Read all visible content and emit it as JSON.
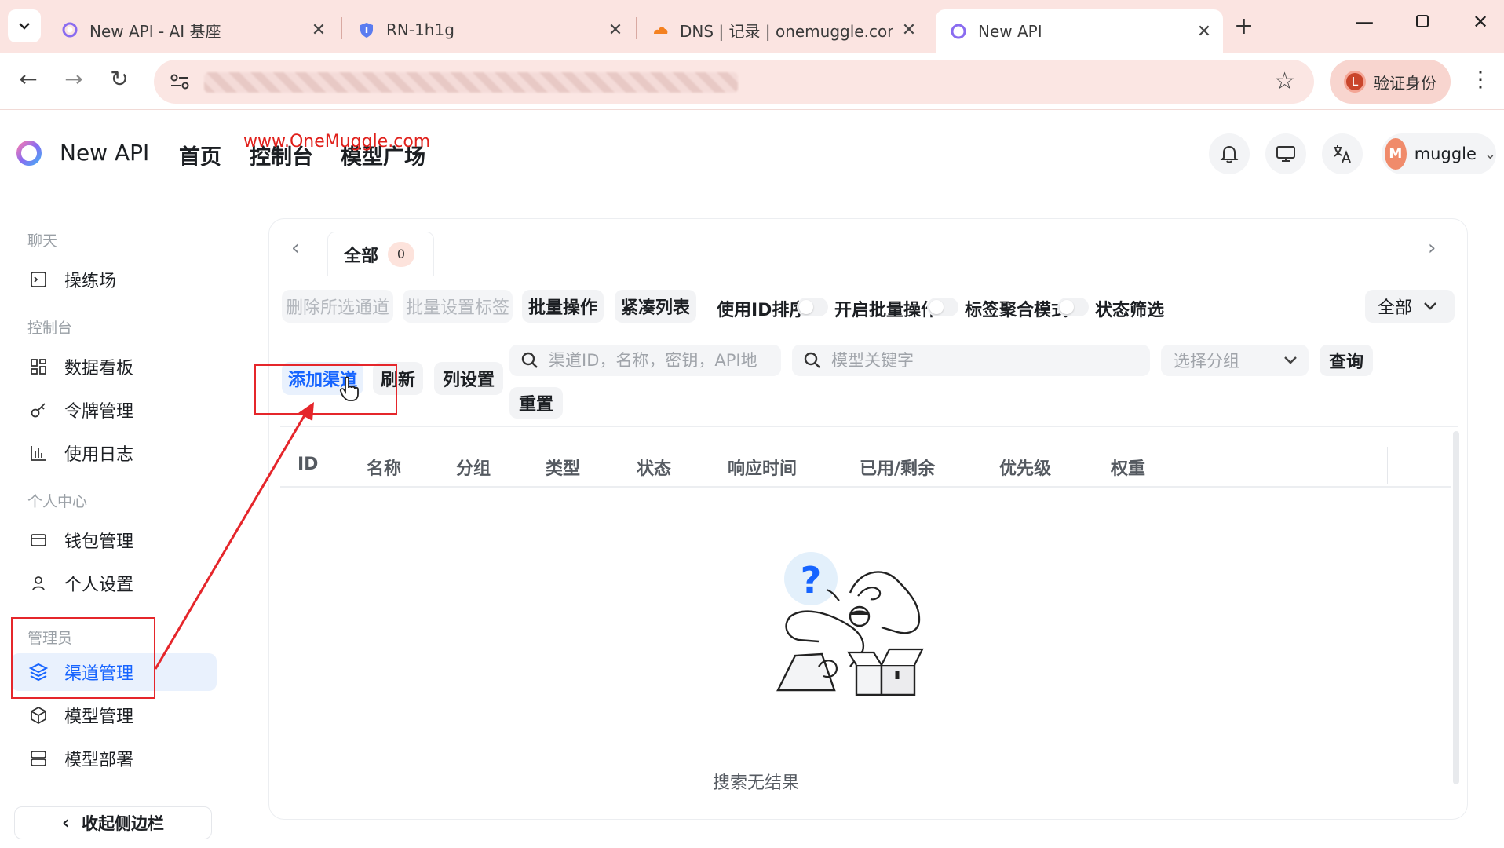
{
  "browser": {
    "tabs": [
      {
        "label": "New API - AI 基座",
        "close": "✕"
      },
      {
        "label": "RN-1h1g",
        "close": "✕"
      },
      {
        "label": "DNS | 记录 | onemuggle.com",
        "close": "✕"
      },
      {
        "label": "New API",
        "close": "✕"
      }
    ],
    "new_tab": "+",
    "verify_label": "验证身份",
    "verify_avatar": "L"
  },
  "header": {
    "app_name": "New API",
    "nav": [
      "首页",
      "控制台",
      "模型广场"
    ],
    "watermark": "www.OneMuggle.com",
    "user": {
      "avatar": "M",
      "name": "muggle"
    }
  },
  "sidebar": {
    "sections": [
      {
        "title": "聊天",
        "items": [
          {
            "label": "操练场",
            "icon": "playground-icon"
          }
        ]
      },
      {
        "title": "控制台",
        "items": [
          {
            "label": "数据看板",
            "icon": "dashboard-icon"
          },
          {
            "label": "令牌管理",
            "icon": "key-icon"
          },
          {
            "label": "使用日志",
            "icon": "chart-icon"
          }
        ]
      },
      {
        "title": "个人中心",
        "items": [
          {
            "label": "钱包管理",
            "icon": "wallet-icon"
          },
          {
            "label": "个人设置",
            "icon": "user-icon"
          }
        ]
      },
      {
        "title": "管理员",
        "items": [
          {
            "label": "渠道管理",
            "icon": "layers-icon",
            "active": true
          },
          {
            "label": "模型管理",
            "icon": "box-icon"
          },
          {
            "label": "模型部署",
            "icon": "server-icon"
          }
        ]
      }
    ],
    "collapse_label": "收起侧边栏"
  },
  "main": {
    "tab_all": {
      "label": "全部",
      "count": "0"
    },
    "toolbar": {
      "delete_selected": "删除所选通道",
      "batch_tag": "批量设置标签",
      "batch_ops": "批量操作",
      "compact_list": "紧凑列表",
      "sort_by_id": "使用ID排序",
      "enable_batch": "开启批量操作",
      "tag_aggregate": "标签聚合模式",
      "status_filter": "状态筛选",
      "status_value": "全部"
    },
    "actions": {
      "add_channel": "添加渠道",
      "refresh": "刷新",
      "column_settings": "列设置",
      "query": "查询",
      "reset": "重置"
    },
    "search": {
      "channel_placeholder": "渠道ID，名称，密钥，API地址",
      "model_placeholder": "模型关键字",
      "group_placeholder": "选择分组"
    },
    "table": {
      "columns": [
        "ID",
        "名称",
        "分组",
        "类型",
        "状态",
        "响应时间",
        "已用/剩余",
        "优先级",
        "权重"
      ]
    },
    "empty_text": "搜索无结果"
  },
  "colors": {
    "accent": "#1664ff",
    "annotation": "#e5262b",
    "tabbar": "#fbe4e1"
  }
}
